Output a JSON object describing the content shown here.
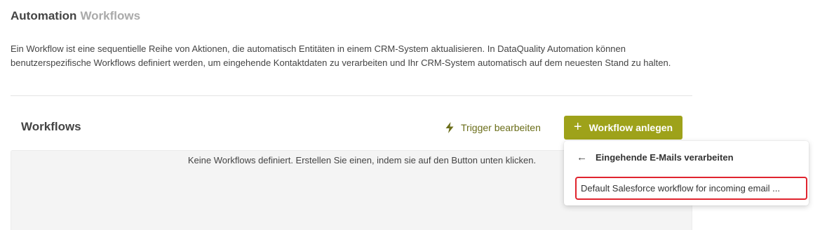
{
  "breadcrumb": {
    "root": "Automation",
    "current": "Workflows"
  },
  "description": "Ein Workflow ist eine sequentielle Reihe von Aktionen, die automatisch Entitäten in einem CRM-System aktualisieren. In DataQuality Automation können benutzerspezifische Workflows definiert werden, um eingehende Kontaktdaten zu verarbeiten und Ihr CRM-System automatisch auf dem neuesten Stand zu halten.",
  "section": {
    "title": "Workflows"
  },
  "toolbar": {
    "trigger_label": "Trigger bearbeiten",
    "trigger_icon": "lightning-icon",
    "create_label": "Workflow anlegen",
    "create_icon": "plus-icon"
  },
  "empty_state": {
    "text": "Keine Workflows definiert. Erstellen Sie einen, indem sie auf den Button unten klicken."
  },
  "dropdown": {
    "back_icon": "arrow-left-icon",
    "header": "Eingehende E-Mails verarbeiten",
    "items": [
      {
        "label": "Default Salesforce workflow for incoming email ..."
      }
    ]
  },
  "colors": {
    "accent": "#9ea21a",
    "accent_text": "#6b6e1a",
    "highlight": "#e0242e"
  }
}
